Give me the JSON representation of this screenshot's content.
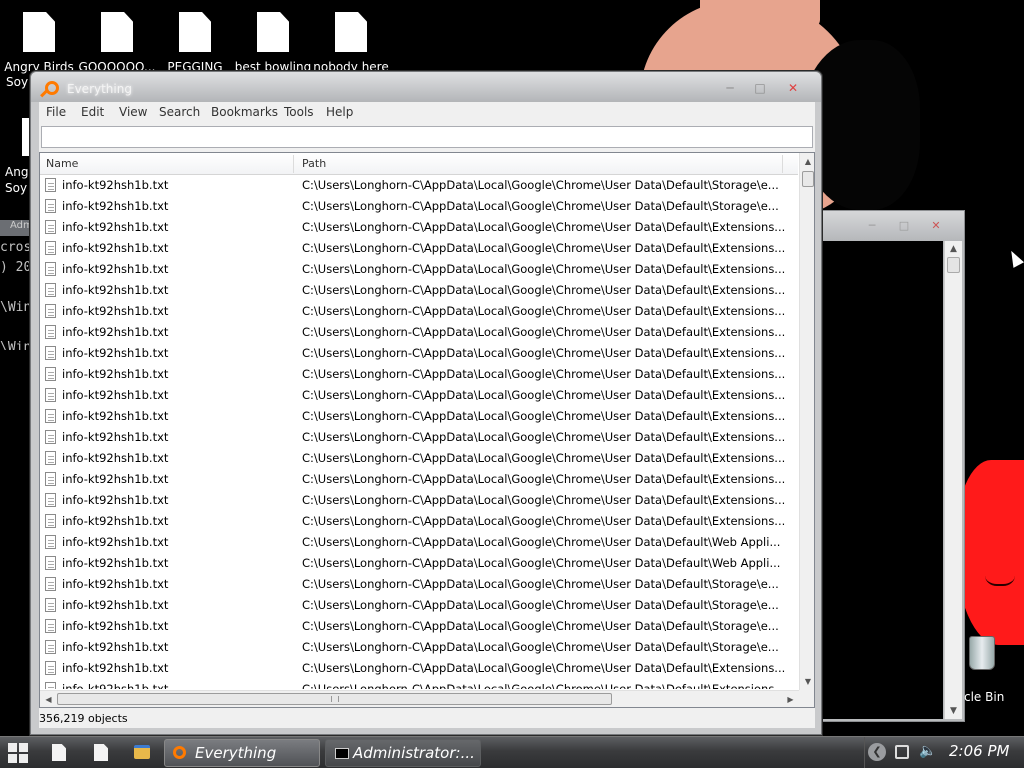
{
  "desktop": {
    "icons": [
      {
        "label": "Angry Birds",
        "label2": "Soy"
      },
      {
        "label": "GOOOOOO..."
      },
      {
        "label": "PEGGING"
      },
      {
        "label": "best bowling"
      },
      {
        "label": "nobody here"
      }
    ],
    "partial_icon_label": "Angr",
    "partial_icon_label2": "Soy V",
    "recycle_bin_label": "cle Bin"
  },
  "console": {
    "title_fragment": "Adm",
    "lines": [
      "cros",
      ") 20",
      "",
      "\\Win",
      "",
      "\\Win"
    ]
  },
  "everything": {
    "title": "Everything",
    "menu": [
      "File",
      "Edit",
      "View",
      "Search",
      "Bookmarks",
      "Tools",
      "Help"
    ],
    "search_value": "",
    "columns": {
      "name": "Name",
      "path": "Path"
    },
    "rows": [
      {
        "name": "info-kt92hsh1b.txt",
        "path": "C:\\Users\\Longhorn-C\\AppData\\Local\\Google\\Chrome\\User Data\\Default\\Storage\\e..."
      },
      {
        "name": "info-kt92hsh1b.txt",
        "path": "C:\\Users\\Longhorn-C\\AppData\\Local\\Google\\Chrome\\User Data\\Default\\Storage\\e..."
      },
      {
        "name": "info-kt92hsh1b.txt",
        "path": "C:\\Users\\Longhorn-C\\AppData\\Local\\Google\\Chrome\\User Data\\Default\\Extensions..."
      },
      {
        "name": "info-kt92hsh1b.txt",
        "path": "C:\\Users\\Longhorn-C\\AppData\\Local\\Google\\Chrome\\User Data\\Default\\Extensions..."
      },
      {
        "name": "info-kt92hsh1b.txt",
        "path": "C:\\Users\\Longhorn-C\\AppData\\Local\\Google\\Chrome\\User Data\\Default\\Extensions..."
      },
      {
        "name": "info-kt92hsh1b.txt",
        "path": "C:\\Users\\Longhorn-C\\AppData\\Local\\Google\\Chrome\\User Data\\Default\\Extensions..."
      },
      {
        "name": "info-kt92hsh1b.txt",
        "path": "C:\\Users\\Longhorn-C\\AppData\\Local\\Google\\Chrome\\User Data\\Default\\Extensions..."
      },
      {
        "name": "info-kt92hsh1b.txt",
        "path": "C:\\Users\\Longhorn-C\\AppData\\Local\\Google\\Chrome\\User Data\\Default\\Extensions..."
      },
      {
        "name": "info-kt92hsh1b.txt",
        "path": "C:\\Users\\Longhorn-C\\AppData\\Local\\Google\\Chrome\\User Data\\Default\\Extensions..."
      },
      {
        "name": "info-kt92hsh1b.txt",
        "path": "C:\\Users\\Longhorn-C\\AppData\\Local\\Google\\Chrome\\User Data\\Default\\Extensions..."
      },
      {
        "name": "info-kt92hsh1b.txt",
        "path": "C:\\Users\\Longhorn-C\\AppData\\Local\\Google\\Chrome\\User Data\\Default\\Extensions..."
      },
      {
        "name": "info-kt92hsh1b.txt",
        "path": "C:\\Users\\Longhorn-C\\AppData\\Local\\Google\\Chrome\\User Data\\Default\\Extensions..."
      },
      {
        "name": "info-kt92hsh1b.txt",
        "path": "C:\\Users\\Longhorn-C\\AppData\\Local\\Google\\Chrome\\User Data\\Default\\Extensions..."
      },
      {
        "name": "info-kt92hsh1b.txt",
        "path": "C:\\Users\\Longhorn-C\\AppData\\Local\\Google\\Chrome\\User Data\\Default\\Extensions..."
      },
      {
        "name": "info-kt92hsh1b.txt",
        "path": "C:\\Users\\Longhorn-C\\AppData\\Local\\Google\\Chrome\\User Data\\Default\\Extensions..."
      },
      {
        "name": "info-kt92hsh1b.txt",
        "path": "C:\\Users\\Longhorn-C\\AppData\\Local\\Google\\Chrome\\User Data\\Default\\Extensions..."
      },
      {
        "name": "info-kt92hsh1b.txt",
        "path": "C:\\Users\\Longhorn-C\\AppData\\Local\\Google\\Chrome\\User Data\\Default\\Extensions..."
      },
      {
        "name": "info-kt92hsh1b.txt",
        "path": "C:\\Users\\Longhorn-C\\AppData\\Local\\Google\\Chrome\\User Data\\Default\\Web Appli..."
      },
      {
        "name": "info-kt92hsh1b.txt",
        "path": "C:\\Users\\Longhorn-C\\AppData\\Local\\Google\\Chrome\\User Data\\Default\\Web Appli..."
      },
      {
        "name": "info-kt92hsh1b.txt",
        "path": "C:\\Users\\Longhorn-C\\AppData\\Local\\Google\\Chrome\\User Data\\Default\\Storage\\e..."
      },
      {
        "name": "info-kt92hsh1b.txt",
        "path": "C:\\Users\\Longhorn-C\\AppData\\Local\\Google\\Chrome\\User Data\\Default\\Storage\\e..."
      },
      {
        "name": "info-kt92hsh1b.txt",
        "path": "C:\\Users\\Longhorn-C\\AppData\\Local\\Google\\Chrome\\User Data\\Default\\Storage\\e..."
      },
      {
        "name": "info-kt92hsh1b.txt",
        "path": "C:\\Users\\Longhorn-C\\AppData\\Local\\Google\\Chrome\\User Data\\Default\\Storage\\e..."
      },
      {
        "name": "info-kt92hsh1b.txt",
        "path": "C:\\Users\\Longhorn-C\\AppData\\Local\\Google\\Chrome\\User Data\\Default\\Extensions..."
      },
      {
        "name": "info-kt92hsh1b.txt",
        "path": "C:\\Users\\Longhorn-C\\AppData\\Local\\Google\\Chrome\\User Data\\Default\\Extensions..."
      }
    ],
    "status": "356,219 objects"
  },
  "taskbar": {
    "buttons": [
      {
        "label": "Everything",
        "icon": "search-icon"
      },
      {
        "label": "Administrator:...",
        "icon": "console-icon"
      }
    ],
    "clock": "2:06 PM"
  }
}
